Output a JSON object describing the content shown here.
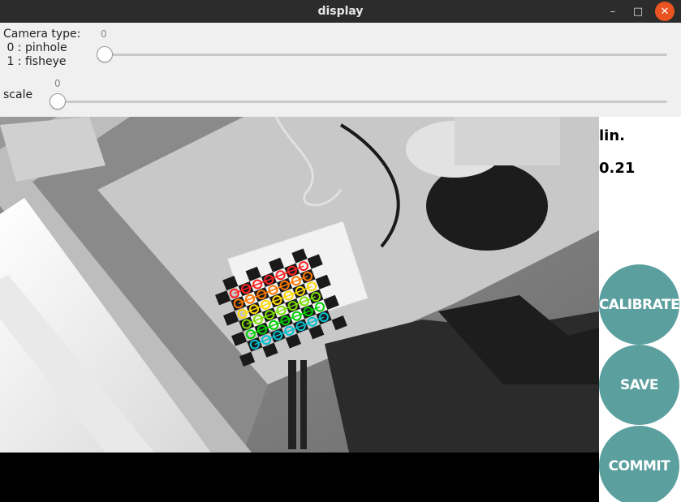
{
  "window": {
    "title": "display",
    "minimize_glyph": "–",
    "maximize_glyph": "□",
    "close_glyph": "✕"
  },
  "controls": {
    "camera_type": {
      "label": "Camera type:\n 0 : pinhole\n 1 : fisheye",
      "value": "0",
      "min": 0,
      "max": 1,
      "current": 0
    },
    "scale": {
      "label": "scale",
      "value": "0",
      "current": 0
    }
  },
  "side_panel": {
    "metric_name": "lin.",
    "metric_value": "0.21",
    "buttons": {
      "calibrate": "CALIBRATE",
      "save": "SAVE",
      "commit": "COMMIT"
    }
  },
  "colors": {
    "button_teal": "#5b9f9f",
    "close_orange": "#e95420",
    "corner_rows": [
      "#ff2020",
      "#ff7a00",
      "#ffd800",
      "#7ee000",
      "#00d000",
      "#00c0d0"
    ]
  },
  "icons": {
    "minimize": "minimize-icon",
    "maximize": "maximize-icon",
    "close": "close-icon"
  }
}
